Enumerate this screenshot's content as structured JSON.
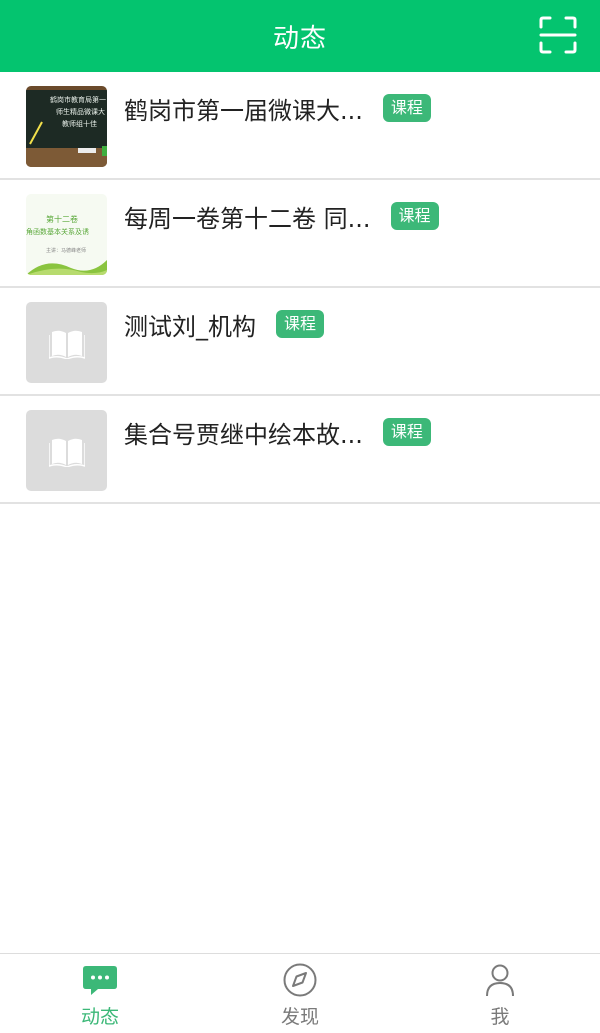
{
  "header": {
    "title": "动态",
    "scan_icon": "scan-icon"
  },
  "items": [
    {
      "title": "鹤岗市第一届微课大...",
      "badge": "课程",
      "thumb": {
        "type": "blackboard",
        "lines": [
          "鹤岗市教育局第一",
          "师生精品微课大",
          "教师组十佳"
        ]
      }
    },
    {
      "title": "每周一卷第十二卷 同...",
      "badge": "课程",
      "thumb": {
        "type": "cover",
        "lines": [
          "第十二卷",
          "角函数基本关系及诱",
          "主讲：马德峰老师"
        ]
      }
    },
    {
      "title": "测试刘_机构",
      "badge": "课程",
      "thumb": {
        "type": "placeholder",
        "icon": "book-icon"
      }
    },
    {
      "title": "集合号贾继中绘本故...",
      "badge": "课程",
      "thumb": {
        "type": "placeholder",
        "icon": "book-icon"
      }
    }
  ],
  "nav": {
    "items": [
      {
        "label": "动态",
        "icon": "chat-bubble-icon",
        "active": true
      },
      {
        "label": "发现",
        "icon": "compass-icon",
        "active": false
      },
      {
        "label": "我",
        "icon": "person-icon",
        "active": false
      }
    ]
  },
  "colors": {
    "brand_green": "#04c46f",
    "badge_green": "#3cb878",
    "nav_inactive": "#7a7a7a"
  }
}
